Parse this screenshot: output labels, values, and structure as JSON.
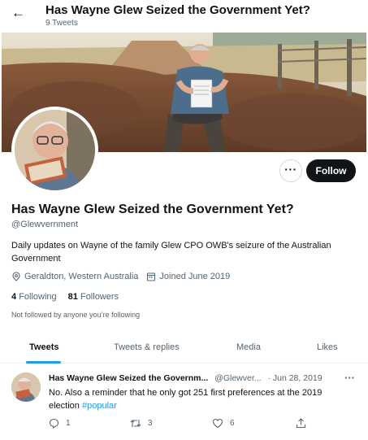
{
  "header": {
    "back_label": "←",
    "title": "Has Wayne Glew Seized the Government Yet?",
    "tweet_count": "9 Tweets"
  },
  "profile": {
    "more_label": "···",
    "follow_label": "Follow",
    "name": "Has Wayne Glew Seized the Government Yet?",
    "handle": "@Glewvernment",
    "bio": "Daily updates on Wayne of the family Glew CPO OWB's seizure of the Australian Government",
    "location": "Geraldton, Western Australia",
    "joined": "Joined June 2019",
    "following_count": "4",
    "following_label": "Following",
    "followers_count": "81",
    "followers_label": "Followers",
    "not_followed": "Not followed by anyone you’re following"
  },
  "tabs": [
    {
      "label": "Tweets",
      "active": true
    },
    {
      "label": "Tweets & replies",
      "active": false
    },
    {
      "label": "Media",
      "active": false
    },
    {
      "label": "Likes",
      "active": false
    }
  ],
  "tweet": {
    "author": "Has Wayne Glew Seized the Governm...",
    "handle": "@Glewver...",
    "date": "· Jun 28, 2019",
    "more_label": "···",
    "text": "No. Also a reminder that he only got 251 first preferences at the 2019 election ",
    "hashtag": "#popular",
    "replies": "1",
    "retweets": "3",
    "likes": "6"
  },
  "colors": {
    "accent": "#1d9bf0",
    "text_primary": "#0f1419",
    "text_secondary": "#536471",
    "follow_bg": "#0f1419"
  },
  "icons": {
    "back": "back-arrow-icon",
    "location": "location-pin-icon",
    "calendar": "calendar-icon",
    "reply": "reply-icon",
    "retweet": "retweet-icon",
    "like": "heart-icon",
    "share": "share-icon"
  }
}
